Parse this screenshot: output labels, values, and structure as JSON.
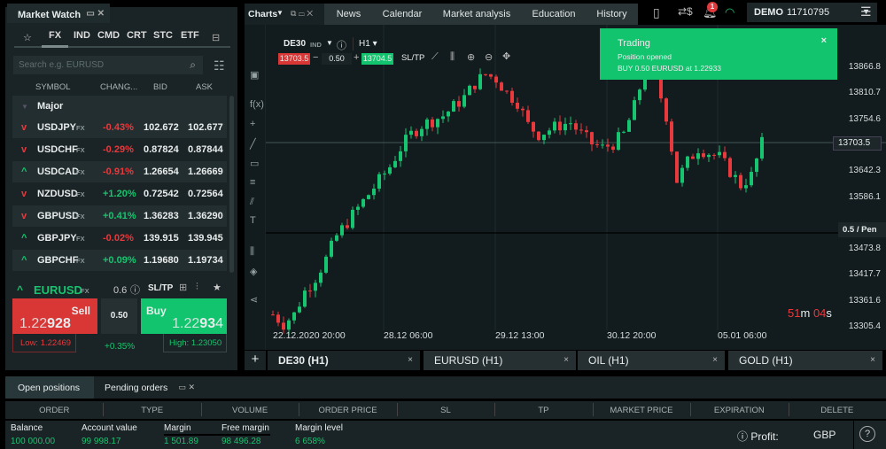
{
  "market_watch": {
    "title": "Market Watch",
    "categories": [
      "FX",
      "IND",
      "CMD",
      "CRT",
      "STC",
      "ETF"
    ],
    "search_placeholder": "Search e.g. EURUSD",
    "columns": [
      "SYMBOL",
      "CHANG...",
      "BID",
      "ASK"
    ],
    "group": "Major",
    "fx_tag": "FX",
    "rows": [
      {
        "symbol": "USDJPY",
        "dir": "down",
        "change": "-0.43%",
        "bid": "102.672",
        "ask": "102.677"
      },
      {
        "symbol": "USDCHF",
        "dir": "down",
        "change": "-0.29%",
        "bid": "0.87824",
        "ask": "0.87844"
      },
      {
        "symbol": "USDCAD",
        "dir": "up",
        "change": "-0.91%",
        "bid": "1.26654",
        "ask": "1.26669"
      },
      {
        "symbol": "NZDUSD",
        "dir": "down",
        "change": "+1.20%",
        "bid": "0.72542",
        "ask": "0.72564"
      },
      {
        "symbol": "GBPUSD",
        "dir": "down",
        "change": "+0.41%",
        "bid": "1.36283",
        "ask": "1.36290"
      },
      {
        "symbol": "GBPJPY",
        "dir": "up",
        "change": "-0.02%",
        "bid": "139.915",
        "ask": "139.945"
      },
      {
        "symbol": "GBPCHF",
        "dir": "up",
        "change": "+0.09%",
        "bid": "1.19680",
        "ask": "1.19734"
      }
    ]
  },
  "ticket": {
    "symbol": "EURUSD",
    "tag": "FX",
    "spread": "0.6",
    "sltp": "SL/TP",
    "sell_label": "Sell",
    "sell_price_a": "1.22",
    "sell_price_b": "928",
    "volume": "0.50",
    "buy_label": "Buy",
    "buy_price_a": "1.22",
    "buy_price_b": "93",
    "buy_price_c": "4",
    "low": "Low: 1.22469",
    "high": "High: 1.23050",
    "change": "+0.35%"
  },
  "topbar": {
    "charts": "Charts",
    "tabs": [
      "News",
      "Calendar",
      "Market analysis",
      "Education",
      "History"
    ],
    "notifications": "1",
    "account_type": "DEMO",
    "account_number": "11710795"
  },
  "chart": {
    "symbol": "DE30",
    "symbol_tag": "IND",
    "timeframe": "H1",
    "bid": "13703.5",
    "volume": "0.50",
    "ask": "13704.5",
    "sltp": "SL/TP",
    "current_price": "13703.5",
    "pending_label": "0.5 / Pen",
    "timer_m": "51",
    "timer_m_unit": "m",
    "timer_s": "04",
    "timer_s_unit": "s"
  },
  "notification": {
    "title": "Trading",
    "line1": "Position opened",
    "line2": "BUY 0.50 EURUSD at 1.22933"
  },
  "chart_data": {
    "type": "candlestick",
    "y_ticks": [
      "13866.8",
      "13810.7",
      "13754.6",
      "13698.5",
      "13642.3",
      "13586.1",
      "13529.9",
      "13473.8",
      "13417.7",
      "13361.6",
      "13305.4"
    ],
    "ylim": [
      13305.4,
      13866.8
    ],
    "x_ticks": [
      "22.12.2020 20:00",
      "28.12 06:00",
      "29.12 13:00",
      "30.12 20:00",
      "05.01 06:00"
    ],
    "approx_close": [
      13330,
      13310,
      13330,
      13380,
      13410,
      13450,
      13500,
      13530,
      13560,
      13590,
      13620,
      13650,
      13690,
      13720,
      13740,
      13750,
      13760,
      13780,
      13800,
      13830,
      13850,
      13840,
      13810,
      13790,
      13740,
      13720,
      13730,
      13740,
      13745,
      13720,
      13700,
      13690,
      13700,
      13720,
      13780,
      13860,
      13840,
      13760,
      13620,
      13660,
      13690,
      13680,
      13670,
      13640,
      13610,
      13630,
      13700
    ]
  },
  "chart_tabs": [
    "DE30 (H1)",
    "EURUSD (H1)",
    "OIL (H1)",
    "GOLD (H1)"
  ],
  "bottom": {
    "tabs": [
      "Open positions",
      "Pending orders"
    ],
    "columns": [
      "ORDER",
      "TYPE",
      "VOLUME",
      "ORDER PRICE",
      "SL",
      "TP",
      "MARKET PRICE",
      "EXPIRATION",
      "DELETE"
    ],
    "summary": [
      {
        "label": "Balance",
        "value": "100 000.00"
      },
      {
        "label": "Account value",
        "value": "99 998.17"
      },
      {
        "label": "Margin",
        "value": "1 501.89"
      },
      {
        "label": "Free margin",
        "value": "98 496.28"
      },
      {
        "label": "Margin level",
        "value": "6 658%"
      }
    ],
    "profit_label": "Profit:",
    "currency": "GBP"
  },
  "colors": {
    "red": "#e8393d",
    "green": "#17c46f",
    "panel": "#1a2325",
    "chart_bg": "#121c1e"
  }
}
